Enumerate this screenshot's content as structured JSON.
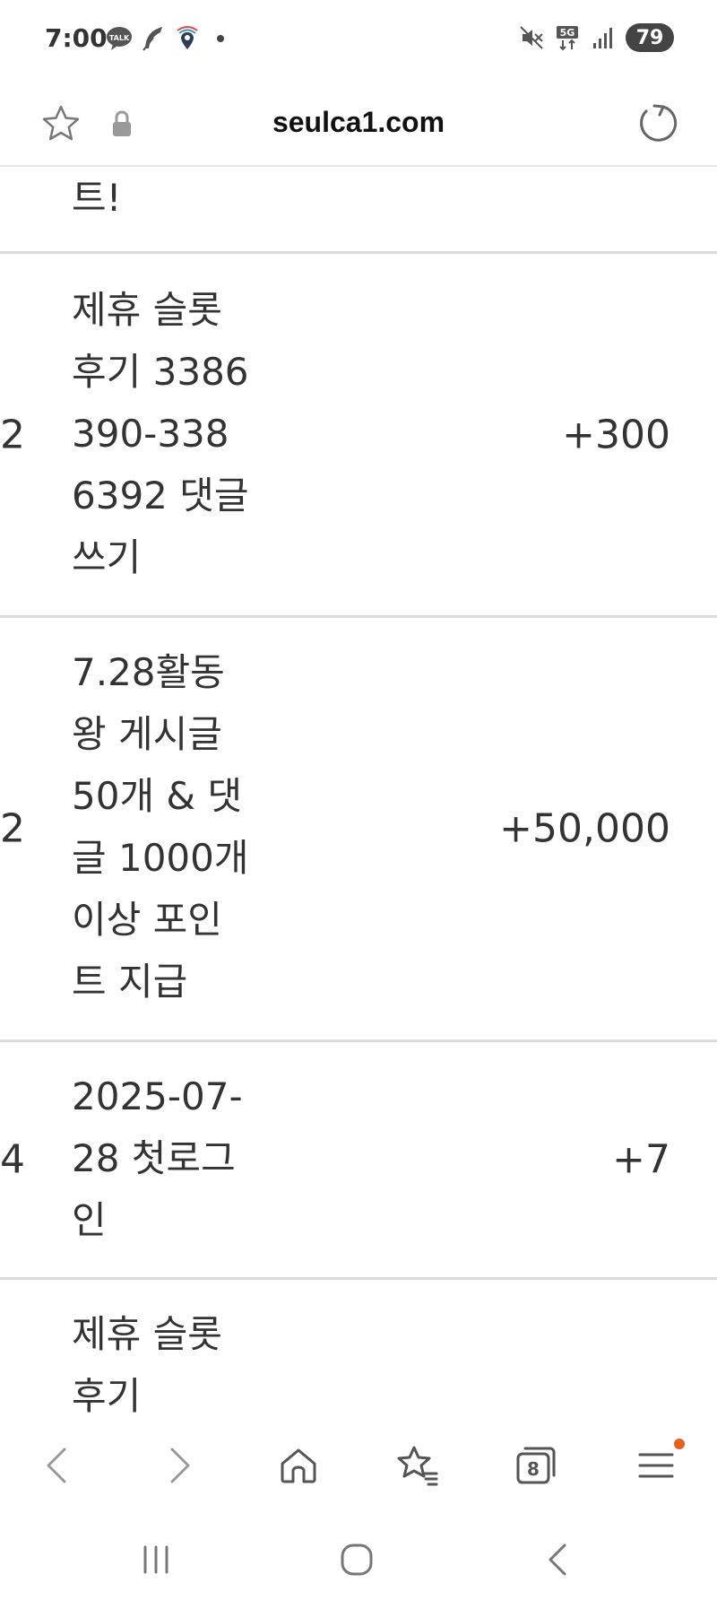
{
  "status_bar": {
    "time": "7:00",
    "left_icons": [
      "talk-icon",
      "feather-icon",
      "map-pin-icon"
    ],
    "right_icons": [
      "mute-icon",
      "5g-icon",
      "signal-icon"
    ],
    "network_label": "5G",
    "battery": "79"
  },
  "address_bar": {
    "url": "seulca1.com",
    "icons": [
      "star-icon",
      "lock-icon",
      "reload-icon"
    ]
  },
  "rows": [
    {
      "num": "",
      "desc": "트!",
      "points": ""
    },
    {
      "num": "2",
      "desc": "제휴 슬롯 후기 3386390-3386392 댓글쓰기",
      "points": "+300"
    },
    {
      "num": "2",
      "desc": "7.28활동왕 게시글 50개 & 댓글 1000개 이상 포인트 지급",
      "points": "+50,000"
    },
    {
      "num": "4",
      "desc": "2025-07-28 첫로그인",
      "points": "+7"
    },
    {
      "num": "",
      "desc": "제휴 슬롯 후기",
      "points": ""
    }
  ],
  "browser_nav": {
    "icons": [
      "back-icon",
      "forward-icon",
      "home-icon",
      "bookmarks-icon",
      "tabs-icon",
      "menu-icon"
    ],
    "tab_count": "8",
    "accent": "#e8601c"
  },
  "system_nav": {
    "icons": [
      "recent-apps-icon",
      "home-circle-icon",
      "system-back-icon"
    ]
  }
}
